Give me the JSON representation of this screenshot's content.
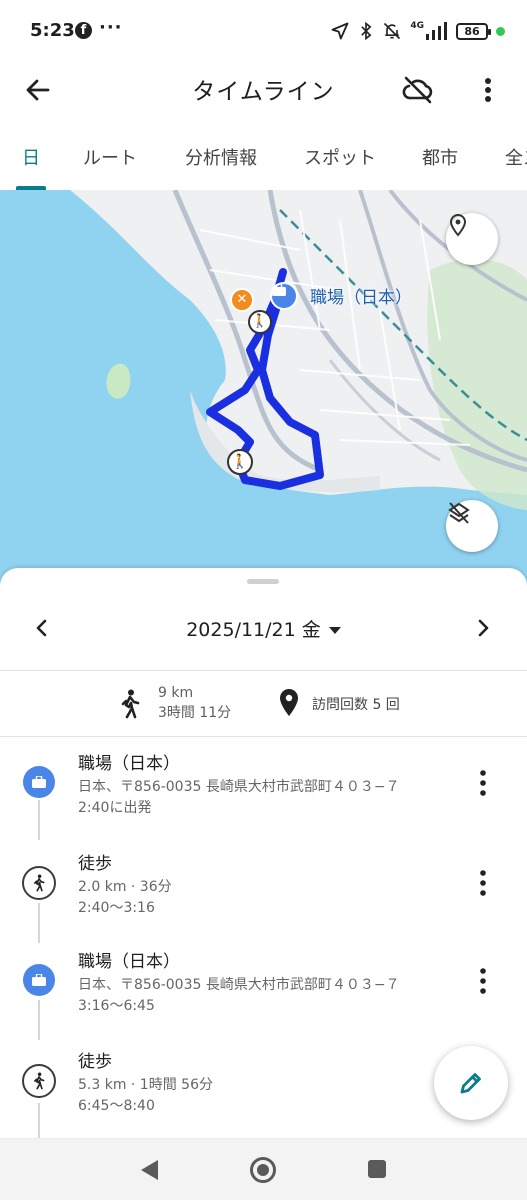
{
  "status_bar": {
    "time": "5:23",
    "more": "···",
    "network": "4G",
    "battery": "86",
    "icons": [
      "facebook-icon",
      "location-arrow-icon",
      "bluetooth-icon",
      "bell-off-icon",
      "signal-icon",
      "battery-icon"
    ]
  },
  "app_bar": {
    "title": "タイムライン",
    "icons": [
      "back-arrow-icon",
      "cloud-off-icon",
      "more-vert-icon"
    ]
  },
  "tabs": {
    "items": [
      "日",
      "ルート",
      "分析情報",
      "スポット",
      "都市",
      "全ス"
    ],
    "active_index": 0,
    "accent": "#0b7d8a"
  },
  "map": {
    "place_label": "職場（日本）",
    "route_color": "#1a2fe0",
    "water_color": "#8fd3f1",
    "land_color": "#eef0f1",
    "icons": [
      "location-pin-icon",
      "layers-off-icon",
      "restaurant-icon",
      "work-briefcase-icon",
      "walk-icon"
    ]
  },
  "sheet": {
    "date": "2025/11/21 金",
    "summary": {
      "distance": "9 km",
      "duration": "3時間 11分",
      "visits": "訪問回数 5 回"
    },
    "items": [
      {
        "type": "place",
        "name": "職場（日本）",
        "line2": "日本、〒856-0035 長崎県大村市武部町４０３−７",
        "line3": "2:40に出発"
      },
      {
        "type": "walk",
        "name": "徒歩",
        "line2": "2.0 km · 36分",
        "line3": "2:40〜3:16"
      },
      {
        "type": "place",
        "name": "職場（日本）",
        "line2": "日本、〒856-0035 長崎県大村市武部町４０３−７",
        "line3": "3:16〜6:45"
      },
      {
        "type": "walk",
        "name": "徒歩",
        "line2": "5.3 km · 1時間 56分",
        "line3": "6:45〜8:40"
      }
    ]
  },
  "colors": {
    "place_icon_bg": "#4a86e8",
    "fab_icon": "#0b7d8a"
  }
}
